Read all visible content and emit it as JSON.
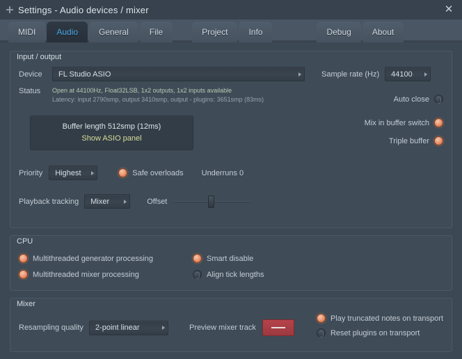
{
  "window": {
    "title": "Settings - Audio devices / mixer",
    "close_label": "✕",
    "icon": "plugin-icon"
  },
  "tabs": {
    "left": [
      {
        "label": "MIDI",
        "active": false
      },
      {
        "label": "Audio",
        "active": true
      },
      {
        "label": "General",
        "active": false
      },
      {
        "label": "File",
        "active": false
      }
    ],
    "middle": [
      {
        "label": "Project",
        "active": false
      },
      {
        "label": "Info",
        "active": false
      }
    ],
    "right": [
      {
        "label": "Debug",
        "active": false
      },
      {
        "label": "About",
        "active": false
      }
    ]
  },
  "input_output": {
    "title": "Input / output",
    "device_label": "Device",
    "device_value": "FL Studio ASIO",
    "status_label": "Status",
    "status_line1": "Open at 44100Hz, Float32LSB, 1x2 outputs, 1x2 inputs available",
    "status_line2": "Latency: input 2790smp, output 3410smp, output - plugins: 3651smp (83ms)",
    "sample_rate_label": "Sample rate (Hz)",
    "sample_rate_value": "44100",
    "auto_close_label": "Auto close",
    "auto_close_state": "off",
    "buffer_length_text": "Buffer length 512smp (12ms)",
    "show_asio_panel_label": "Show ASIO panel",
    "mix_in_buffer_label": "Mix in buffer switch",
    "mix_in_buffer_state": "on",
    "triple_buffer_label": "Triple buffer",
    "triple_buffer_state": "on",
    "priority_label": "Priority",
    "priority_value": "Highest",
    "safe_overloads_label": "Safe overloads",
    "safe_overloads_state": "on",
    "underruns_label": "Underruns 0",
    "playback_tracking_label": "Playback tracking",
    "playback_tracking_value": "Mixer",
    "offset_label": "Offset"
  },
  "cpu": {
    "title": "CPU",
    "multithreaded_generator_label": "Multithreaded generator processing",
    "multithreaded_generator_state": "on",
    "multithreaded_mixer_label": "Multithreaded mixer processing",
    "multithreaded_mixer_state": "on",
    "smart_disable_label": "Smart disable",
    "smart_disable_state": "on",
    "align_tick_lengths_label": "Align tick lengths",
    "align_tick_lengths_state": "off"
  },
  "mixer": {
    "title": "Mixer",
    "resampling_label": "Resampling quality",
    "resampling_value": "2-point linear",
    "preview_track_label": "Preview mixer track",
    "preview_track_value": "—",
    "play_truncated_label": "Play truncated notes on transport",
    "play_truncated_state": "on",
    "reset_plugins_label": "Reset plugins on transport",
    "reset_plugins_state": "off"
  },
  "colors": {
    "accent_on": "#e8906a",
    "tab_active_text": "#4aa8e8",
    "status_ok": "#b9c9b2",
    "link": "#d9dd9a",
    "red_button": "#b5434a"
  }
}
